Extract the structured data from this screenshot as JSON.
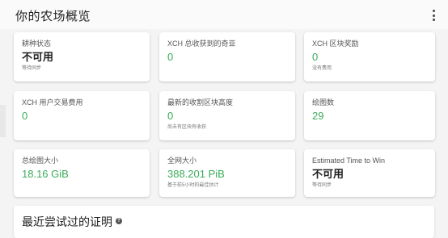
{
  "header": {
    "title": "你的农场概览"
  },
  "cards": [
    {
      "label": "耕种状态",
      "value": "不可用",
      "sub": "等待同步"
    },
    {
      "label": "XCH 总收获到的奇亚",
      "value": "0",
      "sub": ""
    },
    {
      "label": "XCH 区块奖励",
      "value": "0",
      "sub": "没有费用"
    },
    {
      "label": "XCH 用户交易费用",
      "value": "0",
      "sub": ""
    },
    {
      "label": "最新的收割区块高度",
      "value": "0",
      "sub": "尚未有区块有收获"
    },
    {
      "label": "绘图数",
      "value": "29",
      "sub": ""
    },
    {
      "label": "总绘图大小",
      "value": "18.16 GiB",
      "sub": ""
    },
    {
      "label": "全网大小",
      "value": "388.201 PiB",
      "sub": "基于前5小时的最佳估计"
    },
    {
      "label": "Estimated Time to Win",
      "value": "不可用",
      "sub": "等待同步"
    }
  ],
  "section": {
    "title": "最近尝试过的证明",
    "help_glyph": "?"
  },
  "colors": {
    "accent_green": "#3aac59",
    "background": "#f4f4f4",
    "card": "#ffffff"
  }
}
